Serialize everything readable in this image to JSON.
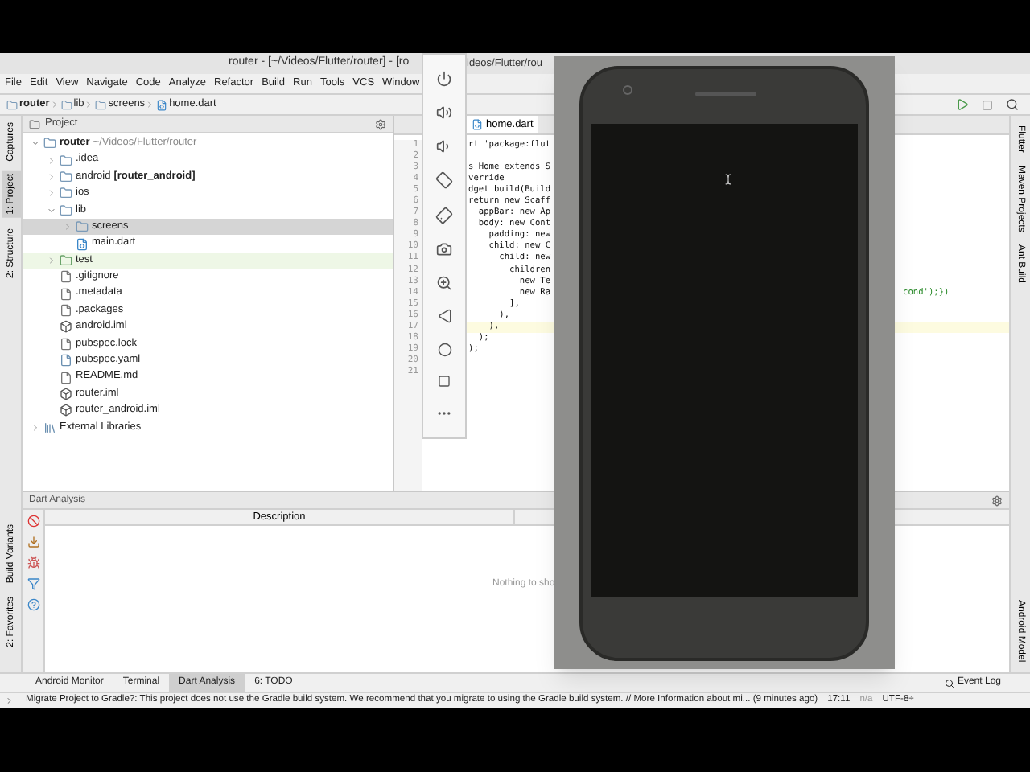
{
  "window": {
    "title": "router - [~/Videos/Flutter/router] - [ro",
    "title_continued": "ideos/Flutter/rou"
  },
  "menu": [
    "File",
    "Edit",
    "View",
    "Navigate",
    "Code",
    "Analyze",
    "Refactor",
    "Build",
    "Run",
    "Tools",
    "VCS",
    "Window"
  ],
  "breadcrumbs": [
    "router",
    "lib",
    "screens",
    "home.dart"
  ],
  "left_tool_tabs_top": [
    {
      "label": "Captures",
      "selected": false
    },
    {
      "label": "1: Project",
      "selected": true
    },
    {
      "label": "2: Structure",
      "selected": false
    }
  ],
  "left_tool_tabs_bottom": [
    {
      "label": "Build Variants",
      "selected": false
    },
    {
      "label": "2: Favorites",
      "selected": false
    }
  ],
  "project_panel": {
    "title": "Project",
    "tree": [
      {
        "kind": "folder",
        "name": "router",
        "location": "~/Videos/Flutter/router",
        "expanded": true,
        "selected": false,
        "children": [
          {
            "kind": "folder",
            "name": ".idea",
            "expanded": false,
            "selected": false
          },
          {
            "kind": "folder",
            "name": "android",
            "module": "[router_android]",
            "expanded": false,
            "selected": false
          },
          {
            "kind": "folder",
            "name": "ios",
            "expanded": false,
            "selected": false
          },
          {
            "kind": "folder",
            "name": "lib",
            "expanded": true,
            "selected": false,
            "children": [
              {
                "kind": "folder",
                "name": "screens",
                "expanded": false,
                "selected": true
              },
              {
                "kind": "dart",
                "name": "main.dart",
                "selected": false
              }
            ]
          },
          {
            "kind": "test",
            "name": "test",
            "expanded": false,
            "selected": false
          },
          {
            "kind": "file",
            "name": ".gitignore",
            "selected": false
          },
          {
            "kind": "file",
            "name": ".metadata",
            "selected": false
          },
          {
            "kind": "file",
            "name": ".packages",
            "selected": false
          },
          {
            "kind": "module",
            "name": "android.iml",
            "selected": false
          },
          {
            "kind": "file",
            "name": "pubspec.lock",
            "selected": false
          },
          {
            "kind": "yaml",
            "name": "pubspec.yaml",
            "selected": false
          },
          {
            "kind": "file",
            "name": "README.md",
            "selected": false
          },
          {
            "kind": "module",
            "name": "router.iml",
            "selected": false
          },
          {
            "kind": "module",
            "name": "router_android.iml",
            "selected": false
          }
        ]
      },
      {
        "kind": "library",
        "name": "External Libraries",
        "expanded": false,
        "selected": false
      }
    ]
  },
  "editor": {
    "tabs": [
      {
        "label": "home.dart",
        "selected": true
      }
    ],
    "lines": [
      {
        "number": "1",
        "code": "rt 'package:flut",
        "current": false
      },
      {
        "number": "2",
        "current": false
      },
      {
        "number": "3",
        "code": "s Home extends S",
        "current": false
      },
      {
        "number": "4",
        "code": "verride",
        "current": false
      },
      {
        "number": "5",
        "code": "dget build(Build",
        "current": false
      },
      {
        "number": "6",
        "code": "return new Scaff",
        "current": false
      },
      {
        "number": "7",
        "code": "  appBar: new Ap",
        "current": false
      },
      {
        "number": "8",
        "code": "  body: new Cont",
        "current": false
      },
      {
        "number": "9",
        "code": "    padding: new",
        "current": false
      },
      {
        "number": "10",
        "code": "    child: new C",
        "current": false
      },
      {
        "number": "11",
        "code": "      child: new",
        "current": false
      },
      {
        "number": "12",
        "code": "        children",
        "current": false
      },
      {
        "number": "13",
        "code": "          new Te",
        "current": false
      },
      {
        "number": "14",
        "code": "          new Ra",
        "tail": "cond');})",
        "current": false
      },
      {
        "number": "15",
        "code": "        ],",
        "current": false
      },
      {
        "number": "16",
        "code": "      ),",
        "current": false
      },
      {
        "number": "17",
        "code": "    ),",
        "current": true
      },
      {
        "number": "18",
        "code": "  );",
        "current": false
      },
      {
        "number": "19",
        "code": ");",
        "current": false
      },
      {
        "number": "20",
        "current": false
      },
      {
        "number": "21",
        "current": false
      }
    ]
  },
  "right_tool_tabs": [
    "Flutter",
    "Maven Projects",
    "Ant Build",
    "Android Model"
  ],
  "analysis": {
    "title": "Dart Analysis",
    "columns": [
      "Description"
    ],
    "empty_text": "Nothing to sho"
  },
  "bottom_tabs": [
    {
      "label": "Android Monitor",
      "selected": false
    },
    {
      "label": "Terminal",
      "selected": false
    },
    {
      "label": "Dart Analysis",
      "selected": true
    },
    {
      "label": "6: TODO",
      "selected": false
    }
  ],
  "event_log": "Event Log",
  "status_bar": {
    "message": "Migrate Project to Gradle?: This project does not use the Gradle build system. We recommend that you migrate to using the Gradle build system. // More Information about mi... (9 minutes ago)",
    "time": "17:11",
    "position": "n/a",
    "encoding": "UTF-8÷"
  }
}
